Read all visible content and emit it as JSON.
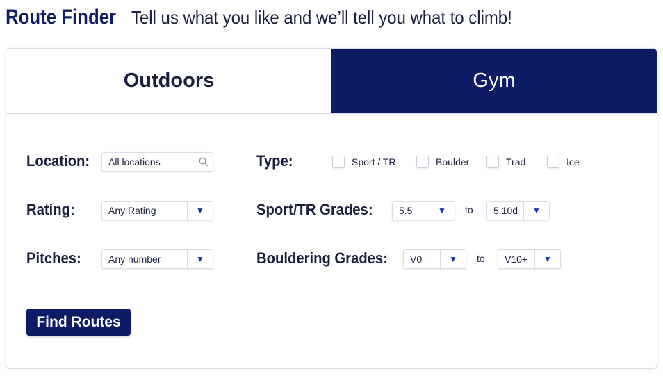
{
  "header": {
    "brand": "Route Finder",
    "tagline": "Tell us what you like and we’ll tell you what to climb!"
  },
  "tabs": [
    {
      "label": "Outdoors",
      "active": true
    },
    {
      "label": "Gym",
      "active": false
    }
  ],
  "filters": {
    "location": {
      "label": "Location:",
      "value": "All locations",
      "icon": "search-icon"
    },
    "rating": {
      "label": "Rating:",
      "value": "Any Rating"
    },
    "pitches": {
      "label": "Pitches:",
      "value": "Any number"
    },
    "type": {
      "label": "Type:",
      "options": [
        {
          "label": "Sport / TR",
          "checked": false
        },
        {
          "label": "Boulder",
          "checked": false
        },
        {
          "label": "Trad",
          "checked": false
        },
        {
          "label": "Ice",
          "checked": false
        }
      ]
    },
    "sport_grades": {
      "label": "Sport/TR Grades:",
      "from": "5.5",
      "to_label": "to",
      "to": "5.10d"
    },
    "bouldering_grades": {
      "label": "Bouldering Grades:",
      "from": "V0",
      "to_label": "to",
      "to": "V10+"
    }
  },
  "submit_label": "Find Routes",
  "colors": {
    "primary": "#0e1c66",
    "arrow": "#1433b8",
    "text": "#1a1f3c",
    "border": "#d9dde6"
  }
}
